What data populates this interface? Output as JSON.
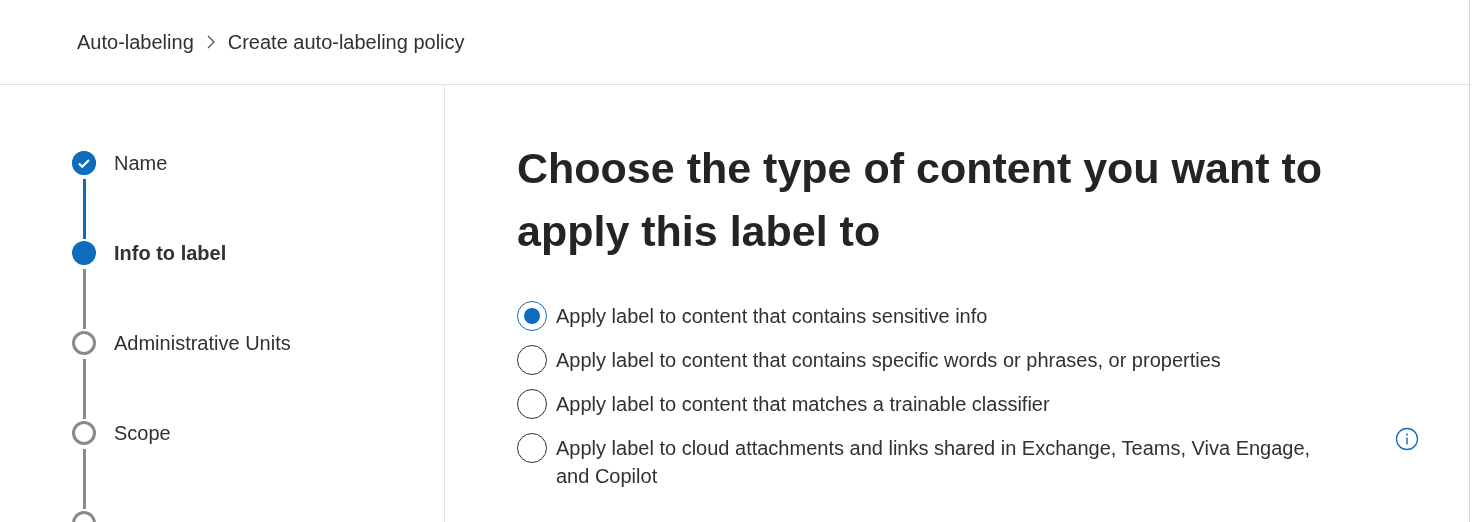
{
  "breadcrumb": [
    {
      "label": "Auto-labeling"
    },
    {
      "label": "Create auto-labeling policy"
    }
  ],
  "steps": [
    {
      "label": "Name",
      "done": true,
      "selected": false
    },
    {
      "label": "Info to label",
      "done": false,
      "selected": true
    },
    {
      "label": "Administrative Units",
      "done": false,
      "selected": false
    },
    {
      "label": "Scope",
      "done": false,
      "selected": false
    },
    {
      "done": false,
      "selected": false
    }
  ],
  "heading": "Choose the type of content you want to apply this label to",
  "options": [
    {
      "label": "Apply label to content that contains sensitive info",
      "selected": true
    },
    {
      "label": "Apply label to content that contains specific words or phrases, or properties",
      "selected": false
    },
    {
      "label": "Apply label to content that matches a trainable classifier",
      "selected": false
    },
    {
      "label": "Apply label to cloud attachments and links shared in Exchange, Teams, Viva Engage, and Copilot",
      "selected": false,
      "info": true
    }
  ]
}
